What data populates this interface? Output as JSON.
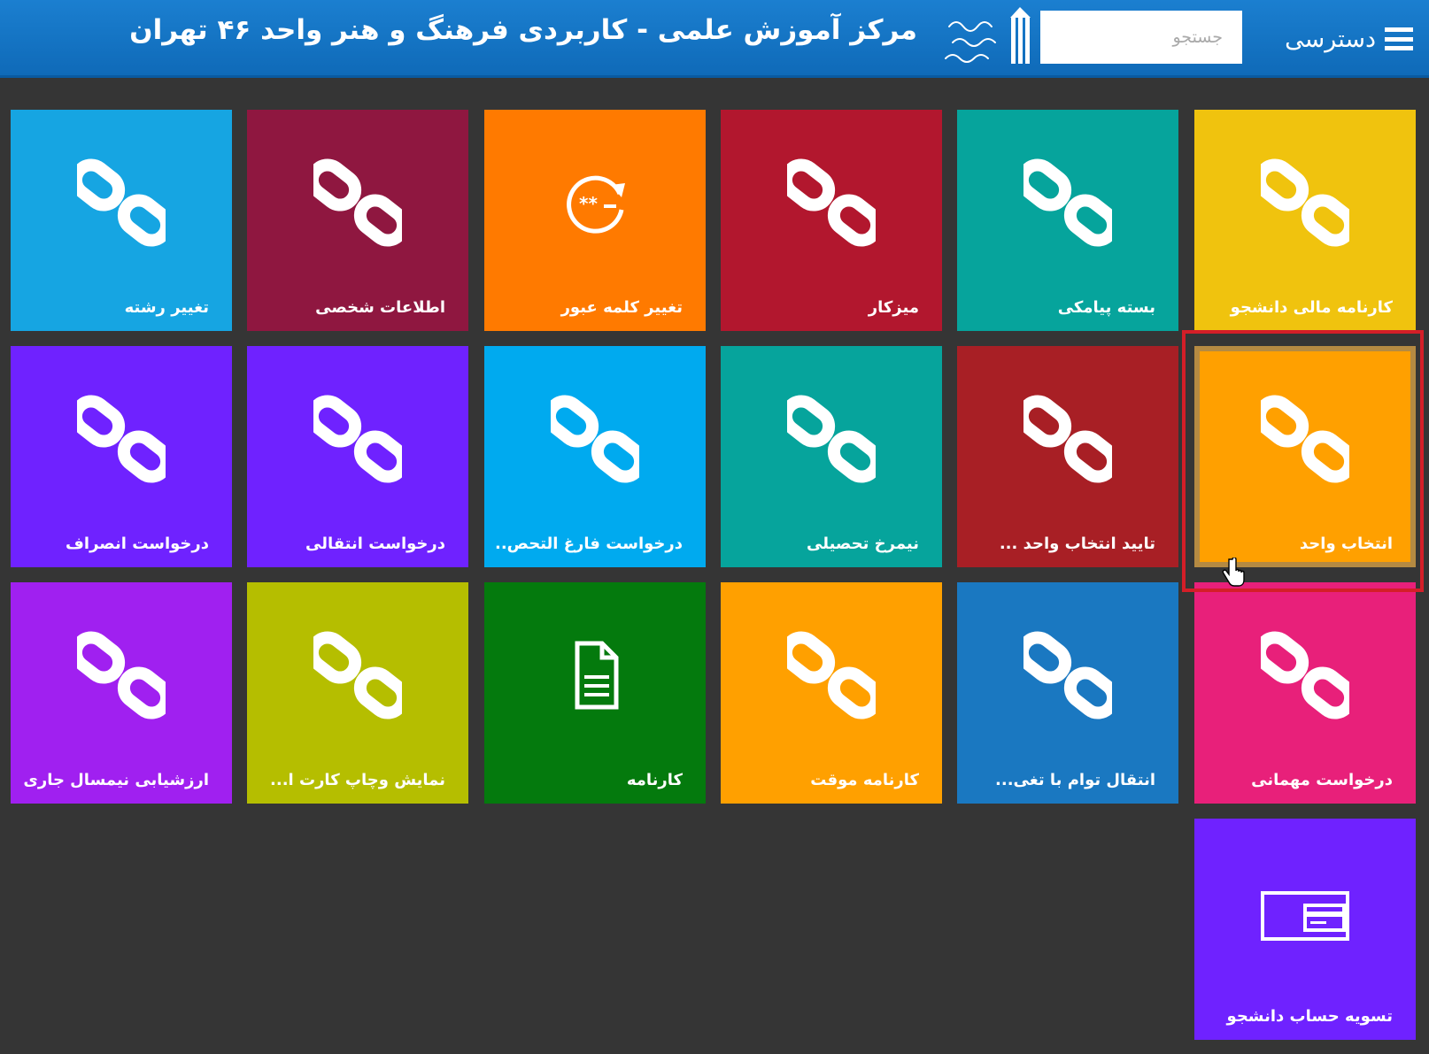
{
  "header": {
    "menu_label": "دسترسی",
    "search_placeholder": "جستجو",
    "title": "مرکز آموزش علمی - کاربردی فرهنگ و هنر واحد ۴۶ تهران"
  },
  "colors": {
    "header": "#1a7bcb",
    "background": "#353535",
    "highlight_border": "#d41e28"
  },
  "tiles": [
    {
      "label": "کارنامه مالی دانشجو",
      "color": "#f0c30e",
      "icon": "link-icon"
    },
    {
      "label": "بسته پیامکی",
      "color": "#06a49c",
      "icon": "link-icon"
    },
    {
      "label": "میزکار",
      "color": "#b2172e",
      "icon": "link-icon"
    },
    {
      "label": "تغییر کلمه عبور",
      "color": "#ff7a00",
      "icon": "password-reset-icon"
    },
    {
      "label": "اطلاعات شخصی",
      "color": "#8f1740",
      "icon": "link-icon"
    },
    {
      "label": "تغییر رشته",
      "color": "#16a5e2",
      "icon": "link-icon"
    },
    {
      "label": "انتخاب واحد",
      "color": "#ffa000",
      "icon": "link-icon",
      "selected": true
    },
    {
      "label": "تایید انتخاب واحد ...",
      "color": "#a81f25",
      "icon": "link-icon"
    },
    {
      "label": "نیمرخ تحصیلی",
      "color": "#06a49c",
      "icon": "link-icon"
    },
    {
      "label": "درخواست فارغ التحص...",
      "color": "#00aaef",
      "icon": "link-icon"
    },
    {
      "label": "درخواست انتقالی",
      "color": "#6f22ff",
      "icon": "link-icon"
    },
    {
      "label": "درخواست انصراف",
      "color": "#6f22ff",
      "icon": "link-icon"
    },
    {
      "label": "درخواست مهمانی",
      "color": "#e8207a",
      "icon": "link-icon"
    },
    {
      "label": "انتقال توام با تغی...",
      "color": "#1a78c1",
      "icon": "link-icon"
    },
    {
      "label": "کارنامه موقت",
      "color": "#ffa000",
      "icon": "link-icon"
    },
    {
      "label": "کارنامه",
      "color": "#047a0d",
      "icon": "document-icon"
    },
    {
      "label": "نمایش وچاپ کارت ا...",
      "color": "#b5be00",
      "icon": "link-icon"
    },
    {
      "label": "ارزشیابی نیمسال جاری",
      "color": "#a020f0",
      "icon": "link-icon"
    },
    {
      "label": "تسویه حساب دانشجو",
      "color": "#6f22ff",
      "icon": "payment-card-icon"
    }
  ]
}
